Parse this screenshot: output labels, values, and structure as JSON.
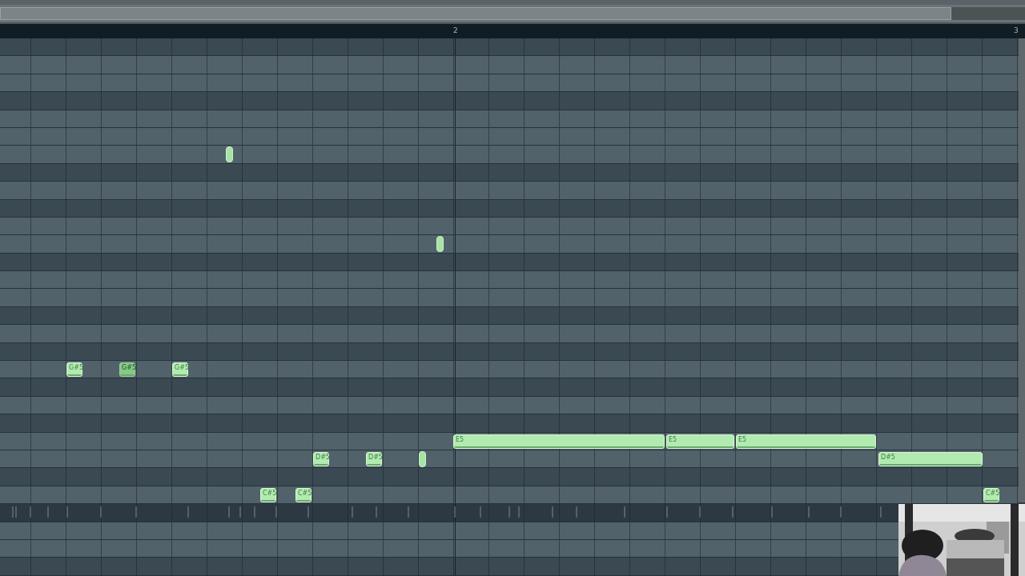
{
  "ruler": {
    "marks": [
      "2",
      "3"
    ]
  },
  "rows": [
    {
      "kind": "dark"
    },
    {
      "kind": "light"
    },
    {
      "kind": "light"
    },
    {
      "kind": "dark"
    },
    {
      "kind": "light"
    },
    {
      "kind": "light"
    },
    {
      "kind": "light",
      "notes": [
        {
          "kind": "blip"
        }
      ]
    },
    {
      "kind": "dark"
    },
    {
      "kind": "light"
    },
    {
      "kind": "dark"
    },
    {
      "kind": "light"
    },
    {
      "kind": "light",
      "notes": [
        {
          "kind": "blip"
        }
      ]
    },
    {
      "kind": "dark"
    },
    {
      "kind": "light"
    },
    {
      "kind": "light"
    },
    {
      "kind": "dark"
    },
    {
      "kind": "light"
    },
    {
      "kind": "dark"
    },
    {
      "kind": "light",
      "notes": [
        {
          "kind": "labeled",
          "label": "G#5"
        },
        {
          "kind": "labeled",
          "label": "G#5",
          "dim": true
        },
        {
          "kind": "labeled",
          "label": "G#5"
        }
      ]
    },
    {
      "kind": "dark"
    },
    {
      "kind": "light"
    },
    {
      "kind": "dark"
    },
    {
      "kind": "light",
      "notes": [
        {
          "kind": "labeled",
          "label": "E5"
        },
        {
          "kind": "labeled",
          "label": "E5"
        },
        {
          "kind": "labeled",
          "label": "E5"
        }
      ]
    },
    {
      "kind": "light",
      "notes": [
        {
          "kind": "labeled",
          "label": "D#5"
        },
        {
          "kind": "labeled",
          "label": "D#5"
        },
        {
          "kind": "blip"
        },
        {
          "kind": "labeled",
          "label": "D#5"
        }
      ]
    },
    {
      "kind": "dark"
    },
    {
      "kind": "light",
      "notes": [
        {
          "kind": "labeled",
          "label": "C#5"
        },
        {
          "kind": "labeled",
          "label": "C#5"
        },
        {
          "kind": "labeled",
          "label": "C#5"
        }
      ]
    },
    {
      "kind": "events"
    },
    {
      "kind": "light"
    },
    {
      "kind": "light"
    },
    {
      "kind": "dark"
    }
  ]
}
